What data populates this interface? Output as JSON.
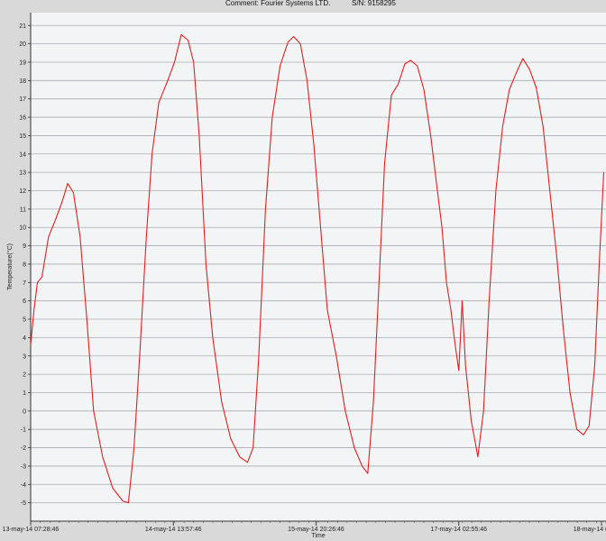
{
  "header": {
    "comment": "Comment: Fourier Systems LTD.",
    "sn": "S/N: 9158295"
  },
  "chart_data": {
    "type": "line",
    "xlabel": "Time",
    "ylabel": "Temperature(°C)",
    "ylim": [
      -6,
      21.7
    ],
    "yticks": [
      -5,
      -4,
      -3,
      -2,
      -1,
      0,
      1,
      2,
      3,
      4,
      5,
      6,
      7,
      8,
      9,
      10,
      11,
      12,
      13,
      14,
      15,
      16,
      17,
      18,
      19,
      20,
      21
    ],
    "xticks": [
      {
        "label": "13-may-14 07:28:46",
        "t": 0
      },
      {
        "label": "14-may-14 13:57:46",
        "t": 1.27
      },
      {
        "label": "15-may-14 20:26:46",
        "t": 2.54
      },
      {
        "label": "17-may-14 02:55:46",
        "t": 3.81
      },
      {
        "label": "18-may-14 09:24:46",
        "t": 5.08
      }
    ],
    "grid": true,
    "color": "#e02020",
    "series": [
      {
        "values": [
          [
            0.0,
            3.6
          ],
          [
            0.03,
            5.5
          ],
          [
            0.06,
            7.0
          ],
          [
            0.1,
            7.3
          ],
          [
            0.16,
            9.5
          ],
          [
            0.22,
            10.4
          ],
          [
            0.28,
            11.4
          ],
          [
            0.33,
            12.4
          ],
          [
            0.38,
            11.9
          ],
          [
            0.44,
            9.5
          ],
          [
            0.5,
            5.0
          ],
          [
            0.56,
            0.0
          ],
          [
            0.64,
            -2.5
          ],
          [
            0.73,
            -4.2
          ],
          [
            0.82,
            -4.9
          ],
          [
            0.87,
            -5.0
          ],
          [
            0.92,
            -2.0
          ],
          [
            0.97,
            3.0
          ],
          [
            1.03,
            9.5
          ],
          [
            1.08,
            14.0
          ],
          [
            1.14,
            16.8
          ],
          [
            1.22,
            18.0
          ],
          [
            1.28,
            19.0
          ],
          [
            1.34,
            20.5
          ],
          [
            1.4,
            20.2
          ],
          [
            1.45,
            19.0
          ],
          [
            1.5,
            15.0
          ],
          [
            1.56,
            8.0
          ],
          [
            1.62,
            4.0
          ],
          [
            1.7,
            0.5
          ],
          [
            1.78,
            -1.5
          ],
          [
            1.86,
            -2.5
          ],
          [
            1.93,
            -2.8
          ],
          [
            1.98,
            -2.0
          ],
          [
            2.03,
            3.0
          ],
          [
            2.09,
            11.0
          ],
          [
            2.15,
            16.0
          ],
          [
            2.22,
            18.8
          ],
          [
            2.29,
            20.1
          ],
          [
            2.34,
            20.4
          ],
          [
            2.4,
            20.0
          ],
          [
            2.46,
            18.0
          ],
          [
            2.52,
            14.5
          ],
          [
            2.58,
            10.0
          ],
          [
            2.64,
            5.5
          ],
          [
            2.72,
            3.0
          ],
          [
            2.8,
            0.0
          ],
          [
            2.88,
            -2.0
          ],
          [
            2.95,
            -3.0
          ],
          [
            3.0,
            -3.4
          ],
          [
            3.05,
            0.5
          ],
          [
            3.1,
            7.0
          ],
          [
            3.15,
            13.5
          ],
          [
            3.21,
            17.2
          ],
          [
            3.27,
            17.8
          ],
          [
            3.33,
            18.9
          ],
          [
            3.38,
            19.1
          ],
          [
            3.44,
            18.8
          ],
          [
            3.5,
            17.5
          ],
          [
            3.56,
            15.0
          ],
          [
            3.61,
            12.5
          ],
          [
            3.66,
            10.0
          ],
          [
            3.7,
            7.0
          ],
          [
            3.74,
            5.5
          ],
          [
            3.78,
            3.5
          ],
          [
            3.81,
            2.2
          ],
          [
            3.84,
            6.0
          ],
          [
            3.87,
            2.5
          ],
          [
            3.92,
            -0.5
          ],
          [
            3.98,
            -2.5
          ],
          [
            4.03,
            0.0
          ],
          [
            4.08,
            6.0
          ],
          [
            4.14,
            12.0
          ],
          [
            4.2,
            15.5
          ],
          [
            4.26,
            17.5
          ],
          [
            4.32,
            18.4
          ],
          [
            4.38,
            19.2
          ],
          [
            4.44,
            18.6
          ],
          [
            4.5,
            17.6
          ],
          [
            4.56,
            15.5
          ],
          [
            4.62,
            12.0
          ],
          [
            4.68,
            8.5
          ],
          [
            4.74,
            4.5
          ],
          [
            4.8,
            1.0
          ],
          [
            4.86,
            -1.0
          ],
          [
            4.92,
            -1.3
          ],
          [
            4.97,
            -0.8
          ],
          [
            5.02,
            2.5
          ],
          [
            5.06,
            8.0
          ],
          [
            5.1,
            13.0
          ]
        ]
      }
    ]
  }
}
